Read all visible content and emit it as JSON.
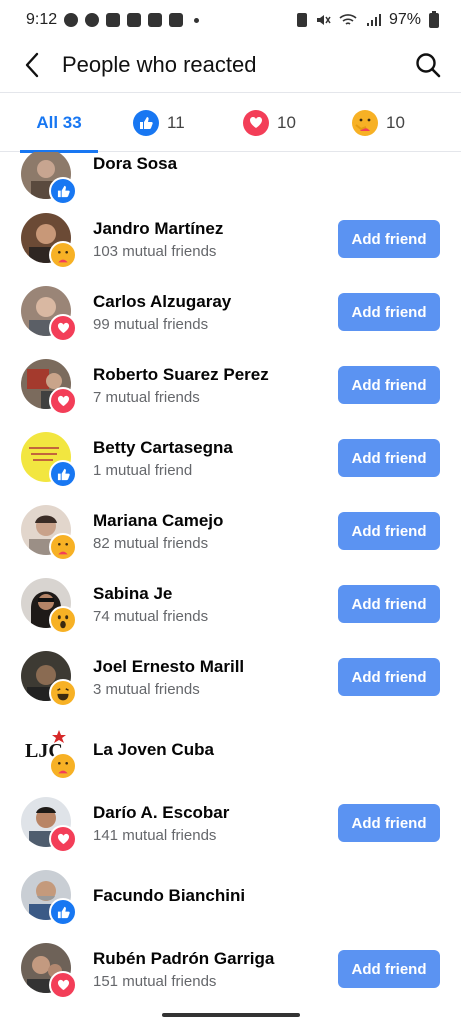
{
  "status": {
    "time": "9:12",
    "battery": "97%"
  },
  "header": {
    "title": "People who reacted"
  },
  "tabs": [
    {
      "label": "All 33"
    },
    {
      "count": "11",
      "icon": "like-icon"
    },
    {
      "count": "10",
      "icon": "love-icon"
    },
    {
      "count": "10",
      "icon": "care-icon"
    }
  ],
  "button_label": "Add friend",
  "people": [
    {
      "name": "Dora Sosa",
      "mutual": "",
      "reaction": "like",
      "has_button": false,
      "avatar_color": "#8d7a6a"
    },
    {
      "name": "Jandro Martínez",
      "mutual": "103 mutual friends",
      "reaction": "care",
      "has_button": true,
      "avatar_color": "#6b4a35"
    },
    {
      "name": "Carlos Alzugaray",
      "mutual": "99 mutual friends",
      "reaction": "love",
      "has_button": true,
      "avatar_color": "#9a8577"
    },
    {
      "name": "Roberto Suarez Perez",
      "mutual": "7 mutual friends",
      "reaction": "love",
      "has_button": true,
      "avatar_color": "#7b6b5d"
    },
    {
      "name": "Betty Cartasegna",
      "mutual": "1 mutual friend",
      "reaction": "like",
      "has_button": true,
      "avatar_color": "#f2e640"
    },
    {
      "name": "Mariana Camejo",
      "mutual": "82 mutual friends",
      "reaction": "care",
      "has_button": true,
      "avatar_color": "#c9b1a0"
    },
    {
      "name": "Sabina Je",
      "mutual": "74 mutual friends",
      "reaction": "wow",
      "has_button": true,
      "avatar_color": "#5a4a44"
    },
    {
      "name": "Joel Ernesto Marill",
      "mutual": "3 mutual friends",
      "reaction": "haha",
      "has_button": true,
      "avatar_color": "#3d3a33"
    },
    {
      "name": "La Joven Cuba",
      "mutual": "",
      "reaction": "care",
      "has_button": false,
      "avatar_color": "#ffffff",
      "avatar_text": "LJC"
    },
    {
      "name": "Darío A. Escobar",
      "mutual": "141 mutual friends",
      "reaction": "love",
      "has_button": true,
      "avatar_color": "#4f5d6e"
    },
    {
      "name": "Facundo Bianchini",
      "mutual": "",
      "reaction": "like",
      "has_button": false,
      "avatar_color": "#8a8f96"
    },
    {
      "name": "Rubén Padrón Garriga",
      "mutual": "151 mutual friends",
      "reaction": "love",
      "has_button": true,
      "avatar_color": "#6e6258"
    }
  ],
  "colors": {
    "accent": "#1877f2",
    "button": "#5b93f2",
    "love": "#f33e58",
    "care": "#f7b125"
  }
}
